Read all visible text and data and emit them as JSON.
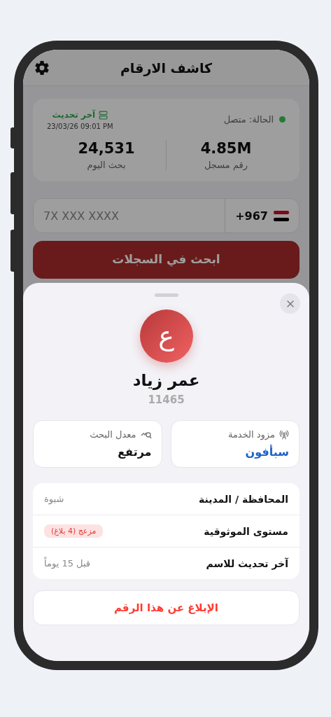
{
  "header": {
    "title": "كاشف الارقام"
  },
  "status": {
    "label": "الحالة: متصل",
    "online": true,
    "update_label": "آخر تحديث",
    "update_time": "23/03/26 09:01 PM"
  },
  "stats": [
    {
      "value": "4.85M",
      "label": "رقم مسجل"
    },
    {
      "value": "24,531",
      "label": "بحث اليوم"
    }
  ],
  "phone_input": {
    "country_code": "+967",
    "placeholder": "7X XXX XXXX"
  },
  "search_button": "ابحث في السجلات",
  "sheet": {
    "avatar_letter": "ع",
    "name": "عمر زياد",
    "number": "11465",
    "cards": [
      {
        "kind": "provider",
        "label": "مزود الخدمة",
        "value": "سبأفون",
        "highlighted": true
      },
      {
        "kind": "rate",
        "label": "معدل البحث",
        "value": "مرتفع",
        "highlighted": false
      }
    ],
    "rows": [
      {
        "kind": "text",
        "label": "المحافظة / المدينة",
        "value": "شبوة"
      },
      {
        "kind": "badge",
        "label": "مستوى الموثوقية",
        "value": "مزعج (4 بلاغ)"
      },
      {
        "kind": "text",
        "label": "آخر تحديث للاسم",
        "value": "قبل 15 يوماً"
      }
    ],
    "report_button": "الإبلاغ عن هذا الرقم"
  }
}
